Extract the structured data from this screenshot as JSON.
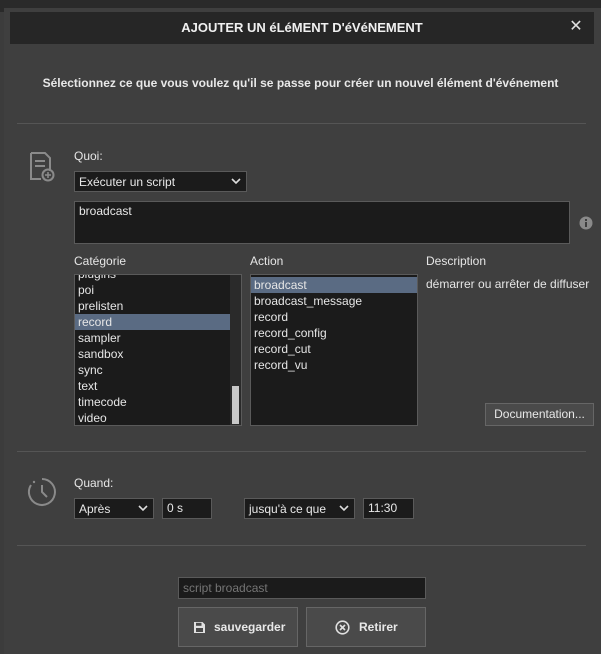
{
  "dialog": {
    "title": "AJOUTER UN éLéMENT D'éVéNEMENT",
    "close_glyph": "✕",
    "intro": "Sélectionnez ce que vous voulez qu'il se passe pour créer un nouvel élément d'événement"
  },
  "what": {
    "label": "Quoi:",
    "type_value": "Exécuter un script",
    "script_text": "broadcast",
    "info_icon": "info-icon"
  },
  "columns": {
    "category_label": "Catégorie",
    "action_label": "Action",
    "description_label": "Description"
  },
  "categories": {
    "partial_top": "plugins",
    "items": [
      "poi",
      "prelisten",
      "record",
      "sampler",
      "sandbox",
      "sync",
      "text",
      "timecode",
      "video"
    ],
    "selected": "record"
  },
  "actions": {
    "items": [
      "broadcast",
      "broadcast_message",
      "record",
      "record_config",
      "record_cut",
      "record_vu"
    ],
    "selected": "broadcast"
  },
  "description": {
    "text": "démarrer ou arrêter de diffuser",
    "doc_button": "Documentation..."
  },
  "when": {
    "label": "Quand:",
    "mode": "Après",
    "delay": "0 s",
    "until": "jusqu'à ce que",
    "time": "11:30"
  },
  "footer": {
    "name_placeholder": "script broadcast",
    "save_label": "sauvegarder",
    "remove_label": "Retirer"
  },
  "colors": {
    "selection": "#5a6b83",
    "field_bg": "#1b1b1b",
    "dialog_bg": "#3f3f3f"
  }
}
